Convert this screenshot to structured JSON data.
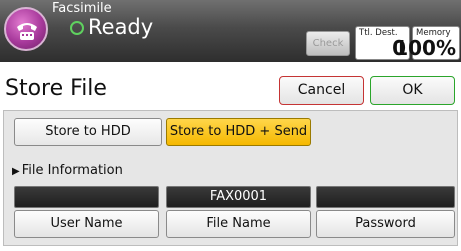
{
  "header": {
    "app_title": "Facsimile",
    "status": "Ready",
    "check_label": "Check",
    "total_dest": {
      "label": "Ttl. Dest.",
      "value": "0"
    },
    "memory": {
      "label": "Memory",
      "value": "100%"
    },
    "status_color": "#5fd15f",
    "icons": [
      "fax-app-icon",
      "ready-status-icon"
    ]
  },
  "title_row": {
    "title": "Store File",
    "cancel_label": "Cancel",
    "ok_label": "OK"
  },
  "store_options": {
    "store_to_hdd": "Store to HDD",
    "store_to_hdd_send": "Store to HDD + Send",
    "selected": "Store to HDD + Send",
    "selected_color": "#f5b800"
  },
  "file_information": {
    "section_label": "File Information",
    "fields": [
      {
        "label": "User Name",
        "value": ""
      },
      {
        "label": "File Name",
        "value": "FAX0001"
      },
      {
        "label": "Password",
        "value": ""
      }
    ]
  }
}
